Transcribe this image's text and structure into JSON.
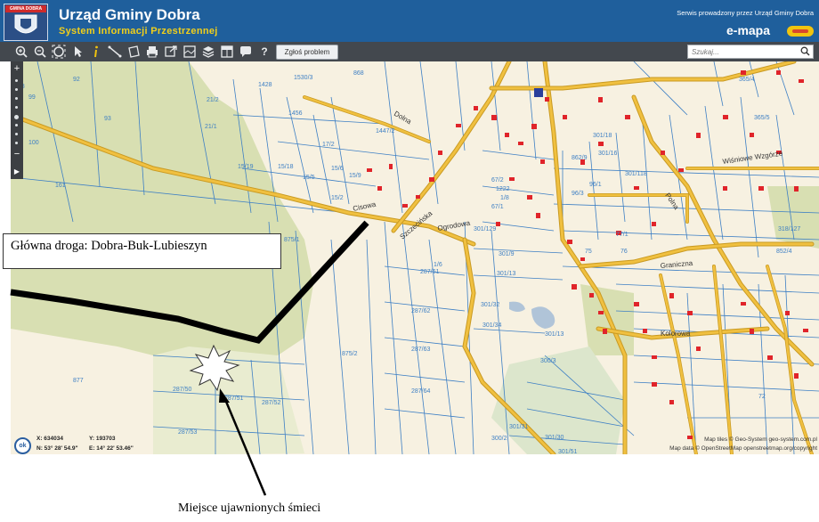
{
  "header": {
    "crest_label": "GMINA DOBRA",
    "title": "Urząd Gminy Dobra",
    "subtitle": "System Informacji Przestrzennej",
    "service_note": "Serwis prowadzony przez Urząd Gminy Dobra",
    "brand": "e-mapa"
  },
  "toolbar": {
    "report_label": "Zgłoś problem",
    "search_placeholder": "Szukaj...",
    "tools": [
      "zoom-in-icon",
      "zoom-out-icon",
      "zoom-extent-icon",
      "pointer-icon",
      "info-icon",
      "measure-length-icon",
      "measure-area-icon",
      "print-icon",
      "export-icon",
      "layers-icon",
      "window-icon",
      "comment-icon",
      "help-icon"
    ]
  },
  "map": {
    "streets": [
      "Ogrodowa",
      "Dolna",
      "Szczecińska",
      "Cisowa",
      "Graniczna",
      "Polna",
      "Wiśniowe Wzgórze",
      "Kolorowa"
    ],
    "parcels": [
      "92",
      "98",
      "99",
      "100",
      "161",
      "93",
      "1428",
      "21/2",
      "21/1",
      "15/19",
      "15/18",
      "15/5",
      "15/6",
      "15/9",
      "15/2",
      "1456",
      "1447/2",
      "1530/3",
      "868",
      "17/2",
      "875/1",
      "875/2",
      "877",
      "287/50",
      "287/51",
      "287/52",
      "287/53",
      "287/61",
      "287/62",
      "287/63",
      "287/64",
      "301/129",
      "301/13",
      "301/34",
      "301/32",
      "301/31",
      "300/2",
      "300/3",
      "301/51",
      "301/30",
      "301/13",
      "301/9",
      "301/18",
      "301/16",
      "301/118",
      "77/1",
      "75",
      "76",
      "72",
      "365/4",
      "365/5",
      "318/127",
      "852/4",
      "862/9",
      "96/1",
      "96/3",
      "67/1",
      "67/2",
      "1222",
      "1/8",
      "1/6",
      "1/13",
      "1/19",
      "70/13"
    ],
    "coord_x_label": "X: 634034",
    "coord_y_label": "Y: 193703",
    "coord_n_label": "N: 53° 28' 54.9\"",
    "coord_e_label": "E: 14° 22' 53.46\"",
    "ok_label": "ok",
    "attribution_tiles": "Map tiles © Geo-System geo-system.com.pl",
    "attribution_data": "Map data © OpenStreetMap openstreetmap.org/copyright"
  },
  "annotations": {
    "main_road_label": "Główna droga: Dobra-Buk-Lubieszyn",
    "dump_site_label": "Miejsce ujawnionych śmieci"
  },
  "colors": {
    "header_bg": "#1f5f9c",
    "title_yellow": "#f1cf1a",
    "toolbar_bg": "#43484e",
    "road_yellow": "#f0c040",
    "road_outline": "#c99a22",
    "parcel_line": "#3d7fc4",
    "building_red": "#e0242a",
    "forest_green": "#d8dfb2",
    "field_beige": "#f7f1e1"
  }
}
